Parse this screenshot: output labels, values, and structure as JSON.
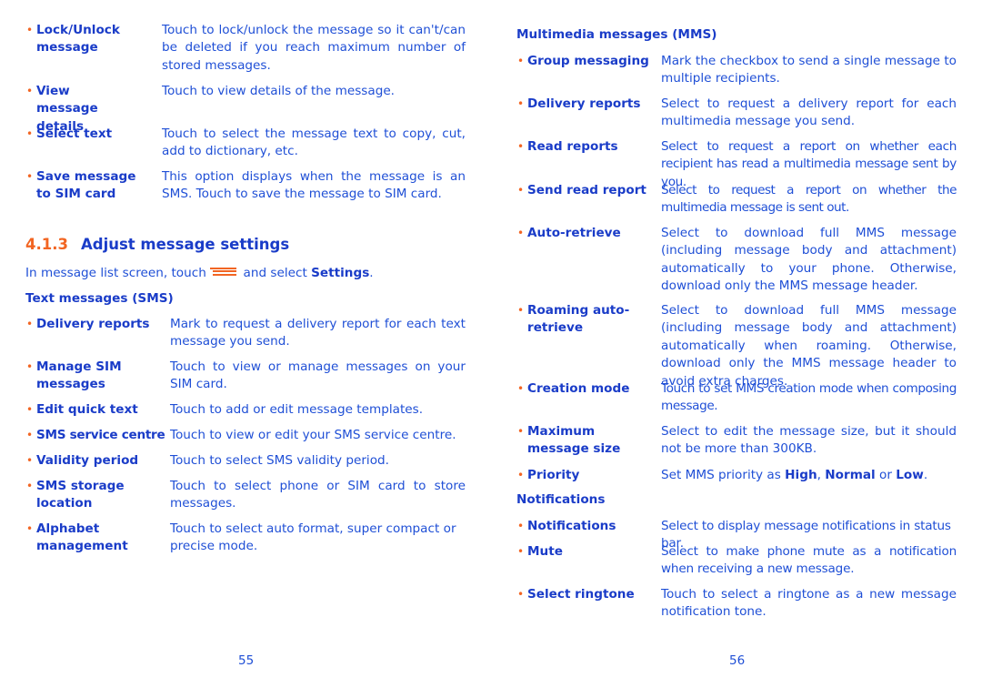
{
  "left_page": {
    "items_top": [
      {
        "term": "Lock/Unlock message",
        "desc": "Touch to lock/unlock the message so it can't/can be deleted if you reach maximum number of stored messages."
      },
      {
        "term": "View message details",
        "desc": "Touch to view details of the message."
      },
      {
        "term": "Select text",
        "desc": "Touch to select the message text to copy, cut, add to dictionary, etc."
      },
      {
        "term": "Save message to SIM card",
        "desc": "This option displays when the message is an SMS. Touch to save the message to SIM card."
      }
    ],
    "section": {
      "number": "4.1.3",
      "title": "Adjust message settings"
    },
    "intro": {
      "before": "In message list screen, touch",
      "icon": "menu-icon",
      "after": "and select",
      "keyword": "Settings",
      "end": "."
    },
    "sms_heading": "Text messages (SMS)",
    "sms_items": [
      {
        "term": "Delivery reports",
        "desc": "Mark to request a delivery report for each text message you send."
      },
      {
        "term": "Manage SIM messages",
        "desc": "Touch to view or manage messages on your SIM card."
      },
      {
        "term": "Edit quick text",
        "desc": "Touch to add or edit message templates."
      },
      {
        "term": "SMS service centre",
        "desc": "Touch to view or edit your SMS service centre."
      },
      {
        "term": "Validity period",
        "desc": "Touch to select SMS validity period."
      },
      {
        "term": "SMS storage location",
        "desc": "Touch to select phone or SIM card to store messages."
      },
      {
        "term": "Alphabet management",
        "desc": "Touch to select auto format, super compact or precise mode."
      }
    ],
    "page_number": "55"
  },
  "right_page": {
    "mms_heading": "Multimedia messages (MMS)",
    "mms_items": [
      {
        "term": "Group messaging",
        "desc": "Mark the checkbox to send a single message to multiple recipients."
      },
      {
        "term": "Delivery reports",
        "desc": "Select to request a delivery report for each multimedia message you send."
      },
      {
        "term": "Read reports",
        "desc": "Select to request a report on whether each recipient has read a multimedia message sent by you."
      },
      {
        "term": "Send read report",
        "desc": "Select to request a report on whether the multimedia message is sent out."
      },
      {
        "term": "Auto-retrieve",
        "desc": "Select to download full MMS message (including message body and attachment) automatically to your phone. Otherwise, download only the MMS message header."
      },
      {
        "term": "Roaming auto-retrieve",
        "desc": "Select to download full MMS message (including message body and attachment) automatically when roaming. Otherwise, download only the MMS message header to avoid extra charges."
      },
      {
        "term": "Creation mode",
        "desc": "Touch to set MMS creation mode when composing message."
      },
      {
        "term": "Maximum message size",
        "desc": "Select to edit the message size, but it should not be more than 300KB."
      }
    ],
    "priority": {
      "term": "Priority",
      "before": "Set MMS priority as",
      "high": "High",
      "sep1": ",",
      "normal": "Normal",
      "or": "or",
      "low": "Low",
      "end": "."
    },
    "notif_heading": "Notifications",
    "notif_items": [
      {
        "term": "Notifications",
        "desc": "Select to display message notifications in status bar."
      },
      {
        "term": "Mute",
        "desc": "Select to make phone mute as a notification when receiving a new message."
      },
      {
        "term": "Select ringtone",
        "desc": "Touch to select a ringtone as a new message notification tone."
      }
    ],
    "page_number": "56"
  }
}
